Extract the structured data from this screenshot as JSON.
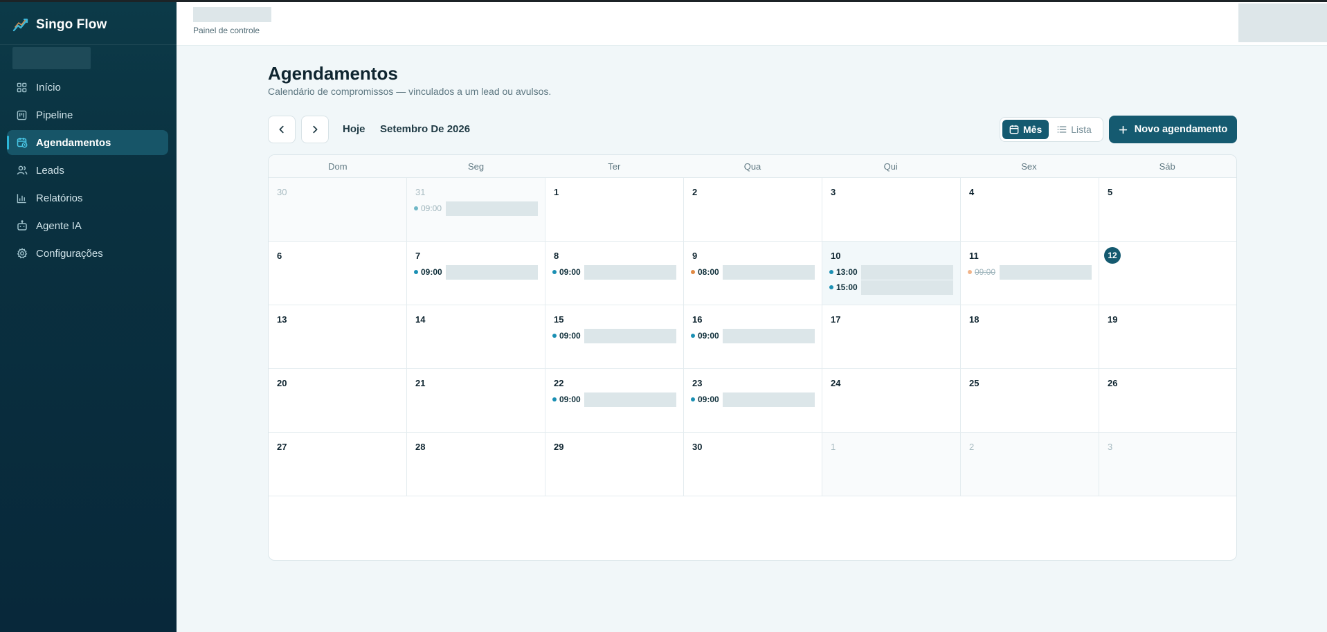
{
  "app": {
    "name": "Singo Flow",
    "logo_icon": "chart-trend-icon"
  },
  "sidebar": {
    "items": [
      {
        "label": "Início",
        "icon": "grid-icon",
        "active": false
      },
      {
        "label": "Pipeline",
        "icon": "kanban-icon",
        "active": false
      },
      {
        "label": "Agendamentos",
        "icon": "calendar-clock-icon",
        "active": true
      },
      {
        "label": "Leads",
        "icon": "users-icon",
        "active": false
      },
      {
        "label": "Relatórios",
        "icon": "bar-chart-icon",
        "active": false
      },
      {
        "label": "Agente IA",
        "icon": "bot-icon",
        "active": false
      },
      {
        "label": "Configurações",
        "icon": "gear-icon",
        "active": false
      }
    ]
  },
  "header": {
    "breadcrumb": "Painel de controle"
  },
  "page": {
    "title": "Agendamentos",
    "subtitle": "Calendário de compromissos — vinculados a um lead ou avulsos."
  },
  "toolbar": {
    "today_label": "Hoje",
    "month_label": "Setembro De 2026",
    "view_month": "Mês",
    "view_list": "Lista",
    "new_button": "Novo agendamento"
  },
  "colors": {
    "accent": "#155a70",
    "dot_blue": "#1a8fb3",
    "dot_orange": "#e08a45",
    "dot_past": "#6fb7c6",
    "dot_cancel": "#f1b48a"
  },
  "calendar": {
    "weekdays": [
      "Dom",
      "Seg",
      "Ter",
      "Qua",
      "Qui",
      "Sex",
      "Sáb"
    ],
    "days": [
      {
        "d": "30",
        "other": true,
        "events": []
      },
      {
        "d": "31",
        "other": true,
        "events": [
          {
            "time": "09:00",
            "status": "past"
          }
        ]
      },
      {
        "d": "1",
        "events": []
      },
      {
        "d": "2",
        "events": []
      },
      {
        "d": "3",
        "events": []
      },
      {
        "d": "4",
        "events": []
      },
      {
        "d": "5",
        "events": []
      },
      {
        "d": "6",
        "events": []
      },
      {
        "d": "7",
        "events": [
          {
            "time": "09:00",
            "status": "blue"
          }
        ]
      },
      {
        "d": "8",
        "events": [
          {
            "time": "09:00",
            "status": "blue"
          }
        ]
      },
      {
        "d": "9",
        "events": [
          {
            "time": "08:00",
            "status": "orange"
          }
        ]
      },
      {
        "d": "10",
        "highlight": true,
        "events": [
          {
            "time": "13:00",
            "status": "blue"
          },
          {
            "time": "15:00",
            "status": "blue"
          }
        ]
      },
      {
        "d": "11",
        "events": [
          {
            "time": "09:00",
            "status": "cancel"
          }
        ]
      },
      {
        "d": "12",
        "current": true,
        "events": []
      },
      {
        "d": "13",
        "events": []
      },
      {
        "d": "14",
        "events": []
      },
      {
        "d": "15",
        "events": [
          {
            "time": "09:00",
            "status": "blue"
          }
        ]
      },
      {
        "d": "16",
        "events": [
          {
            "time": "09:00",
            "status": "blue"
          }
        ]
      },
      {
        "d": "17",
        "events": []
      },
      {
        "d": "18",
        "events": []
      },
      {
        "d": "19",
        "events": []
      },
      {
        "d": "20",
        "events": []
      },
      {
        "d": "21",
        "events": []
      },
      {
        "d": "22",
        "events": [
          {
            "time": "09:00",
            "status": "blue"
          }
        ]
      },
      {
        "d": "23",
        "events": [
          {
            "time": "09:00",
            "status": "blue"
          }
        ]
      },
      {
        "d": "24",
        "events": []
      },
      {
        "d": "25",
        "events": []
      },
      {
        "d": "26",
        "events": []
      },
      {
        "d": "27",
        "events": []
      },
      {
        "d": "28",
        "events": []
      },
      {
        "d": "29",
        "events": []
      },
      {
        "d": "30",
        "events": []
      },
      {
        "d": "1",
        "other": true,
        "events": []
      },
      {
        "d": "2",
        "other": true,
        "events": []
      },
      {
        "d": "3",
        "other": true,
        "events": []
      }
    ]
  }
}
